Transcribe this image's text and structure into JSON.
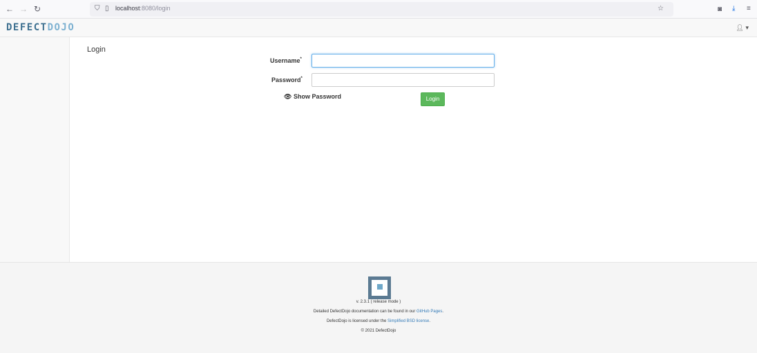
{
  "browser": {
    "url_host": "localhost",
    "url_rest": ":8080/login"
  },
  "header": {
    "logo_part1": "DEFECT",
    "logo_part2": "DOJO",
    "user_icon": "user-icon",
    "caret_icon": "caret-down-icon"
  },
  "main": {
    "title": "Login",
    "username_label": "Username",
    "password_label": "Password",
    "required_mark": "*",
    "username_value": "",
    "password_value": "",
    "show_password_label": "Show Password",
    "login_button": "Login"
  },
  "footer": {
    "version": "v. 2.3.1 ( release mode )",
    "docs_text": "Detailed DefectDojo documentation can be found in our ",
    "docs_link": "GitHub Pages",
    "docs_end": ".",
    "license_text": "DefectDojo is licensed under the ",
    "license_link": "Simplified BSD license",
    "license_end": ".",
    "copyright": "© 2021 DefectDojo"
  },
  "colors": {
    "login_button": "#5cb85c",
    "logo_dark": "#3c6f8f",
    "logo_light": "#7db1d1",
    "link": "#337ab7"
  }
}
